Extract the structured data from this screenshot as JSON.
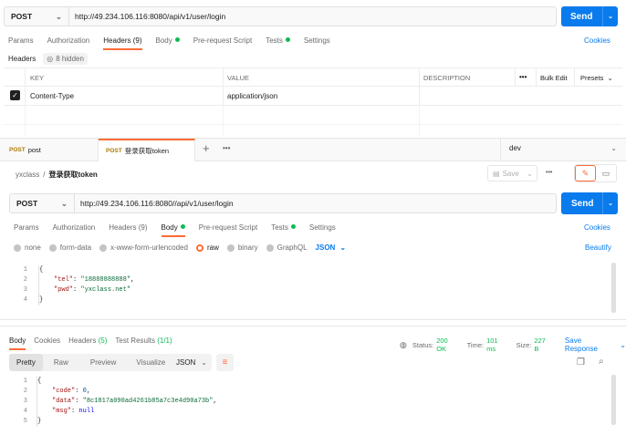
{
  "top_request": {
    "method": "POST",
    "url": "http://49.234.106.116:8080/api/v1/user/login",
    "send": "Send"
  },
  "top_tabs": [
    {
      "label": "Params",
      "active": false,
      "dot": false
    },
    {
      "label": "Authorization",
      "active": false,
      "dot": false
    },
    {
      "label": "Headers (9)",
      "active": true,
      "dot": false
    },
    {
      "label": "Body",
      "active": false,
      "dot": true
    },
    {
      "label": "Pre-request Script",
      "active": false,
      "dot": false
    },
    {
      "label": "Tests",
      "active": false,
      "dot": true
    },
    {
      "label": "Settings",
      "active": false,
      "dot": false
    }
  ],
  "cookies": "Cookies",
  "headers_section": {
    "label": "Headers",
    "hidden": "8 hidden"
  },
  "headers_table": {
    "columns": [
      "KEY",
      "VALUE",
      "DESCRIPTION"
    ],
    "more": "•••",
    "bulk_edit": "Bulk Edit",
    "presets": "Presets",
    "rows": [
      {
        "checked": true,
        "key": "Content-Type",
        "value": "application/json"
      }
    ]
  },
  "tabs": [
    {
      "method": "POST",
      "name": "post",
      "active": false
    },
    {
      "method": "POST",
      "name": "登录获取token",
      "active": true
    }
  ],
  "tab_more": "•••",
  "environment": "dev",
  "breadcrumb": {
    "collection": "yxclass",
    "request": "登录获取token"
  },
  "save": "Save",
  "request": {
    "method": "POST",
    "url": "http://49.234.106.116:8080//api/v1/user/login",
    "send": "Send"
  },
  "request_tabs": [
    {
      "label": "Params",
      "active": false,
      "dot": false
    },
    {
      "label": "Authorization",
      "active": false,
      "dot": false
    },
    {
      "label": "Headers (9)",
      "active": false,
      "dot": false
    },
    {
      "label": "Body",
      "active": true,
      "dot": true
    },
    {
      "label": "Pre-request Script",
      "active": false,
      "dot": false
    },
    {
      "label": "Tests",
      "active": false,
      "dot": true
    },
    {
      "label": "Settings",
      "active": false,
      "dot": false
    }
  ],
  "body_types": [
    {
      "label": "none",
      "selected": false
    },
    {
      "label": "form-data",
      "selected": false
    },
    {
      "label": "x-www-form-urlencoded",
      "selected": false
    },
    {
      "label": "raw",
      "selected": true
    },
    {
      "label": "binary",
      "selected": false
    },
    {
      "label": "GraphQL",
      "selected": false
    }
  ],
  "body_format": "JSON",
  "beautify": "Beautify",
  "request_body": {
    "line_numbers": [
      "1",
      "2",
      "3",
      "4"
    ],
    "open": "{",
    "close": "}",
    "tel_key": "\"tel\"",
    "tel_value": "\"18888888888\"",
    "pwd_key": "\"pwd\"",
    "pwd_value": "\"yxclass.net\""
  },
  "response_tabs": [
    {
      "label": "Body",
      "active": true
    },
    {
      "label": "Cookies",
      "active": false
    },
    {
      "label": "Headers",
      "count": "(5)",
      "active": false
    },
    {
      "label": "Test Results",
      "count": "(1/1)",
      "active": false
    }
  ],
  "response_status": {
    "status_label": "Status:",
    "status": "200 OK",
    "time_label": "Time:",
    "time": "101 ms",
    "size_label": "Size:",
    "size": "227 B",
    "save_response": "Save Response"
  },
  "response_views": [
    "Pretty",
    "Raw",
    "Preview",
    "Visualize"
  ],
  "response_format": "JSON",
  "response_body": {
    "line_numbers": [
      "1",
      "2",
      "3",
      "4",
      "5"
    ],
    "open": "{",
    "close": "}",
    "code_key": "\"code\"",
    "code_value": "0",
    "data_key": "\"data\"",
    "data_value": "\"8c1817a090ad4261b85a7c3e4d90a73b\"",
    "msg_key": "\"msg\"",
    "msg_value": "null"
  },
  "colors": {
    "accent": "#ff6c37",
    "send": "#097bed",
    "success": "#0cbb52"
  }
}
